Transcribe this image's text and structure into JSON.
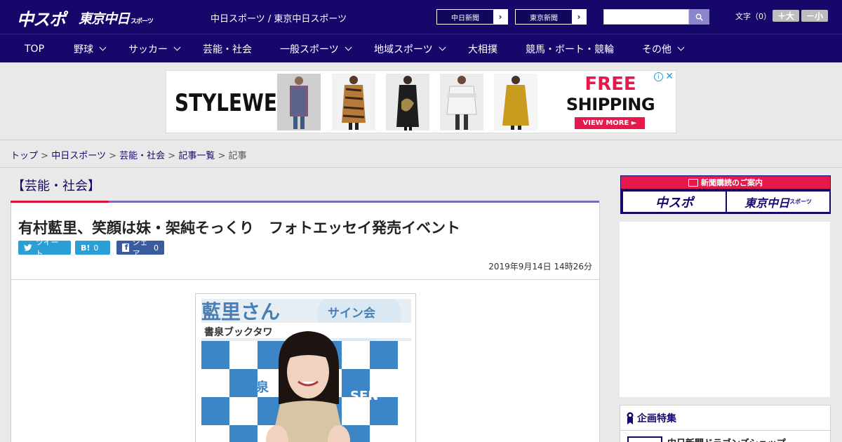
{
  "header": {
    "logo_main": "中スポ",
    "logo_tokyo": "東京中日",
    "logo_tokyo_small": "スポーツ",
    "site_names": "中日スポーツ / 東京中日スポーツ",
    "newspaper_links": [
      {
        "label": "中日新聞"
      },
      {
        "label": "東京新聞"
      }
    ],
    "search": {
      "placeholder": "",
      "value": ""
    },
    "font_size_label": "文字（0）",
    "font_bigger": "＋大",
    "font_smaller": "－小"
  },
  "nav": {
    "items": [
      {
        "label": "TOP",
        "dropdown": false
      },
      {
        "label": "野球",
        "dropdown": true
      },
      {
        "label": "サッカー",
        "dropdown": true
      },
      {
        "label": "芸能・社会",
        "dropdown": false
      },
      {
        "label": "一般スポーツ",
        "dropdown": true
      },
      {
        "label": "地域スポーツ",
        "dropdown": true
      },
      {
        "label": "大相撲",
        "dropdown": false
      },
      {
        "label": "競馬・ボート・競輪",
        "dropdown": false
      },
      {
        "label": "その他",
        "dropdown": true
      }
    ]
  },
  "ad": {
    "brand": "STYLEWE",
    "headline1": "FREE",
    "headline2": "SHIPPING",
    "cta": "VIEW MORE ►",
    "info_icon": "info-icon",
    "close_icon": "close-icon",
    "colors": {
      "accent": "#e5194c"
    }
  },
  "breadcrumb": {
    "items": [
      "トップ",
      "中日スポーツ",
      "芸能・社会",
      "記事一覧"
    ],
    "current": "記事",
    "separator": ">"
  },
  "article": {
    "category": "【芸能・社会】",
    "title": "有村藍里、笑顔は妹・架純そっくり　フォトエッセイ発売イベント",
    "share": {
      "tweet_label": "ツイート",
      "hatena_label": "B!",
      "hatena_count": "0",
      "fb_label": "シェア",
      "fb_count": "0"
    },
    "date": "2019年9月14日 14時26分",
    "photo_sign_text": "藍里さん",
    "photo_event_text": "サイン会",
    "photo_store_text": "書泉ブックタワ",
    "photo_backdrop_text": "書泉",
    "photo_backdrop_text2": "SEN"
  },
  "sidebar": {
    "subscription_title": "新聞購読のご案内",
    "sub_logo_1": "中スポ",
    "sub_logo_2": "東京中日",
    "sub_logo_2_small": "スポーツ",
    "feature_title": "企画特集",
    "feature_item": "中日新聞ドラゴンズショップ"
  },
  "colors": {
    "header_bg": "#16086b",
    "category_red": "#d8143a",
    "category_purple": "#7b6bb8",
    "twitter": "#2a9fd6",
    "facebook": "#3b5b9f"
  }
}
